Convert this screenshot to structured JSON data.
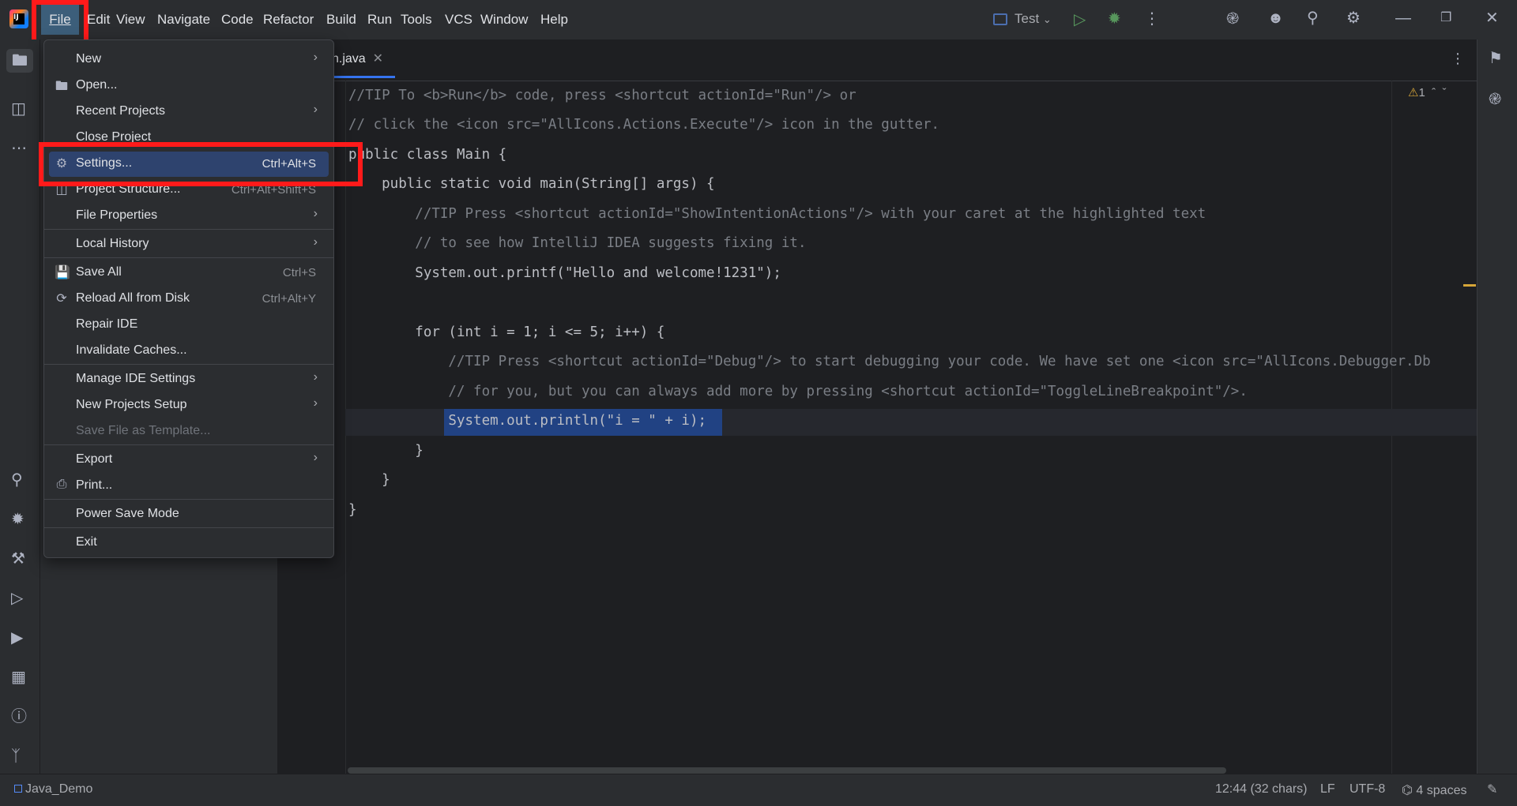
{
  "menubar": {
    "items": [
      "File",
      "Edit",
      "View",
      "Navigate",
      "Code",
      "Refactor",
      "Build",
      "Run",
      "Tools",
      "VCS",
      "Window",
      "Help"
    ]
  },
  "toolbar": {
    "run_config": "Test",
    "run_config_icon": "run-config-icon"
  },
  "editor": {
    "tab_title": "n.java",
    "code_lines": [
      "//TIP To <b>Run</b> code, press <shortcut actionId=\"Run\"/> or",
      "// click the <icon src=\"AllIcons.Actions.Execute\"/> icon in the gutter.",
      "public class Main {",
      "    public static void main(String[] args) {",
      "        //TIP Press <shortcut actionId=\"ShowIntentionActions\"/> with your caret at the highlighted text",
      "        // to see how IntelliJ IDEA suggests fixing it.",
      "        System.out.printf(\"Hello and welcome!1231\");",
      "",
      "        for (int i = 1; i <= 5; i++) {",
      "            //TIP Press <shortcut actionId=\"Debug\"/> to start debugging your code. We have set one <icon src=\"AllIcons.Debugger.Db",
      "            // for you, but you can always add more by pressing <shortcut actionId=\"ToggleLineBreakpoint\"/>.",
      "            System.out.println(\"i = \" + i);",
      "        }",
      "    }",
      "}"
    ],
    "warning_count": "1"
  },
  "file_menu": {
    "items": [
      {
        "label": "New",
        "shortcut": "",
        "submenu": true,
        "icon": ""
      },
      {
        "label": "Open...",
        "shortcut": "",
        "submenu": false,
        "icon": "folder-icon"
      },
      {
        "label": "Recent Projects",
        "shortcut": "",
        "submenu": true,
        "icon": ""
      },
      {
        "label": "Close Project",
        "shortcut": "",
        "submenu": false,
        "icon": ""
      },
      {
        "label": "Settings...",
        "shortcut": "Ctrl+Alt+S",
        "submenu": false,
        "icon": "gear-icon"
      },
      {
        "label": "Project Structure...",
        "shortcut": "Ctrl+Alt+Shift+S",
        "submenu": false,
        "icon": "project-structure-icon"
      },
      {
        "label": "File Properties",
        "shortcut": "",
        "submenu": true,
        "icon": ""
      },
      {
        "label": "Local History",
        "shortcut": "",
        "submenu": true,
        "icon": ""
      },
      {
        "label": "Save All",
        "shortcut": "Ctrl+S",
        "submenu": false,
        "icon": "save-icon"
      },
      {
        "label": "Reload All from Disk",
        "shortcut": "Ctrl+Alt+Y",
        "submenu": false,
        "icon": "reload-icon"
      },
      {
        "label": "Repair IDE",
        "shortcut": "",
        "submenu": false,
        "icon": ""
      },
      {
        "label": "Invalidate Caches...",
        "shortcut": "",
        "submenu": false,
        "icon": ""
      },
      {
        "label": "Manage IDE Settings",
        "shortcut": "",
        "submenu": true,
        "icon": ""
      },
      {
        "label": "New Projects Setup",
        "shortcut": "",
        "submenu": true,
        "icon": ""
      },
      {
        "label": "Save File as Template...",
        "shortcut": "",
        "submenu": false,
        "icon": "",
        "disabled": true
      },
      {
        "label": "Export",
        "shortcut": "",
        "submenu": true,
        "icon": ""
      },
      {
        "label": "Print...",
        "shortcut": "",
        "submenu": false,
        "icon": "printer-icon"
      },
      {
        "label": "Power Save Mode",
        "shortcut": "",
        "submenu": false,
        "icon": ""
      },
      {
        "label": "Exit",
        "shortcut": "",
        "submenu": false,
        "icon": ""
      }
    ]
  },
  "statusbar": {
    "project": "Java_Demo",
    "position": "12:44 (32 chars)",
    "line_sep": "LF",
    "encoding": "UTF-8",
    "indent": "4 spaces"
  },
  "colors": {
    "accent": "#3574f0",
    "selection": "#214283",
    "highlight_box": "#ff1a1a",
    "menu_hover": "#2e436e"
  }
}
